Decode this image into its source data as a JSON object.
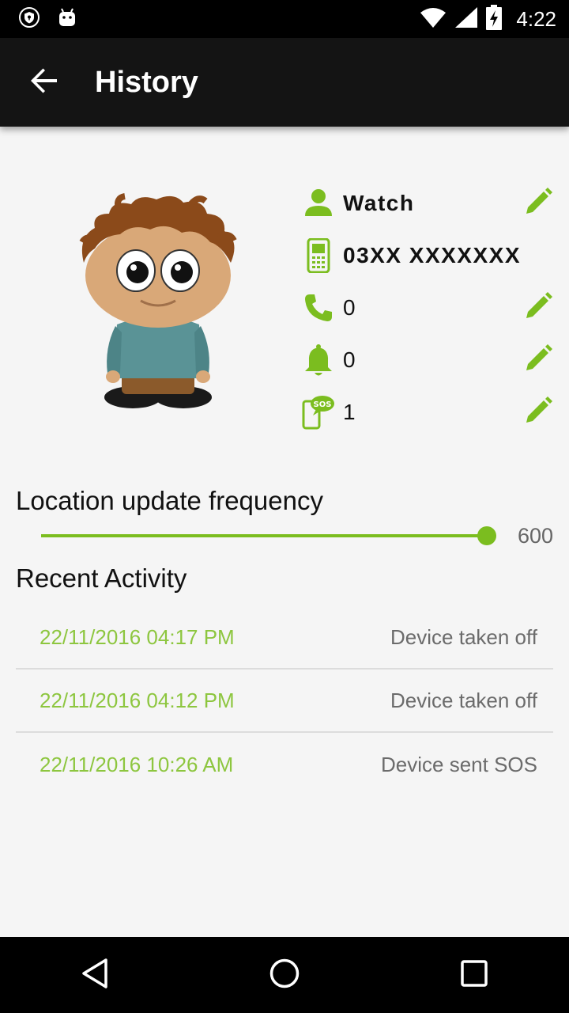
{
  "status_bar": {
    "time": "4:22"
  },
  "app_bar": {
    "title": "History"
  },
  "profile": {
    "name": "Watch",
    "phone": "03XX XXXXXXX",
    "calls": "0",
    "alerts": "0",
    "sos": "1",
    "sos_badge": "SOS"
  },
  "location": {
    "label": "Location update frequency",
    "value": "600",
    "fill_fraction": 0.98
  },
  "activity": {
    "title": "Recent Activity",
    "items": [
      {
        "time": "22/11/2016 04:17 PM",
        "event": "Device taken off"
      },
      {
        "time": "22/11/2016 04:12 PM",
        "event": "Device taken off"
      },
      {
        "time": "22/11/2016 10:26 AM",
        "event": "Device sent SOS"
      }
    ]
  },
  "colors": {
    "accent": "#7bbd1f",
    "activity_time": "#8dc63f",
    "app_bar": "#141414",
    "background": "#f5f5f5"
  },
  "icons": [
    "shield-icon",
    "android-icon",
    "wifi-icon",
    "signal-icon",
    "battery-icon",
    "back-arrow-icon",
    "person-icon",
    "phone-device-icon",
    "call-icon",
    "bell-icon",
    "sos-phone-icon",
    "pencil-icon",
    "nav-back-icon",
    "nav-home-icon",
    "nav-recents-icon"
  ]
}
